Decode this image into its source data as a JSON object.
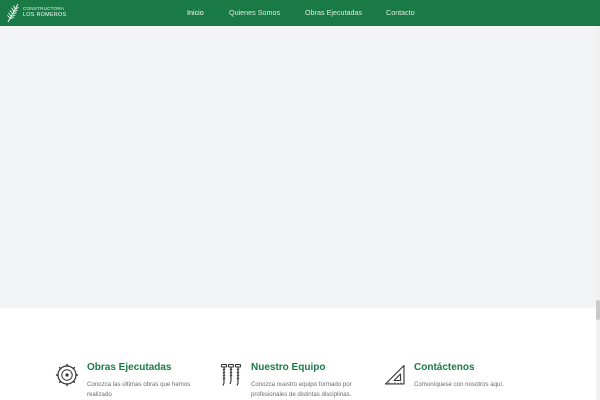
{
  "brand": {
    "line1": "CONSTRUCTORA",
    "line2": "LOS ROMEROS"
  },
  "nav": {
    "items": [
      {
        "label": "Inicio",
        "active": true
      },
      {
        "label": "Quienes Somos",
        "active": false
      },
      {
        "label": "Obras Ejecutadas",
        "active": false
      },
      {
        "label": "Contacto",
        "active": false
      }
    ]
  },
  "features": [
    {
      "title": "Obras Ejecutadas",
      "description": "Conozca las últimas obras que hemos realizado",
      "icon": "saw-blade-icon"
    },
    {
      "title": "Nuestro Equipo",
      "description": "Conozca nuestro equipo formado por profesionales de distintas disciplinas.",
      "icon": "screws-icon"
    },
    {
      "title": "Contáctenos",
      "description": "Comuníquese con nosotros aquí.",
      "icon": "set-square-icon"
    }
  ],
  "colors": {
    "brand_green": "#1a7a45",
    "hero_bg": "#f3f4f6",
    "text_muted": "#6b6b6b"
  }
}
